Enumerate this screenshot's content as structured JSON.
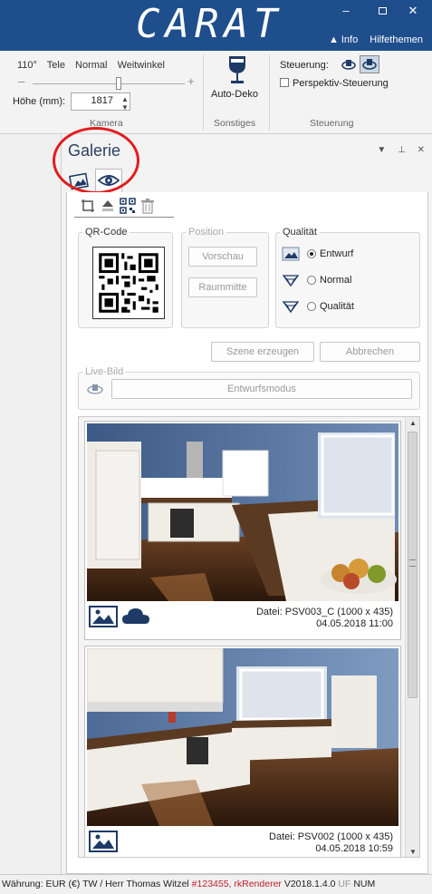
{
  "titlebar": {
    "logo": "CARAT",
    "min": "–",
    "close": "✕",
    "info": "▲ Info",
    "help": "Hilfethemen",
    "bg_color": "#1f4e8c"
  },
  "ribbon": {
    "camera": {
      "presets": [
        "110°",
        "Tele",
        "Normal",
        "Weitwinkel"
      ],
      "minus": "–",
      "plus": "+",
      "height_label": "Höhe (mm):",
      "height_value": "1817",
      "group_label": "Kamera"
    },
    "sonstiges": {
      "autodeko_label": "Auto-Deko",
      "group_label": "Sonstiges"
    },
    "steuerung": {
      "label": "Steuerung:",
      "perspektiv_label": "Perspektiv-Steuerung",
      "group_label": "Steuerung"
    }
  },
  "gallery": {
    "title": "Galerie",
    "ctrl_dropdown": "▼",
    "ctrl_pin": "⊥",
    "ctrl_close": "✕",
    "highlight_color": "#e01e1e",
    "qr": {
      "title": "QR-Code"
    },
    "position": {
      "title": "Position",
      "preview_button": "Vorschau",
      "center_button": "Raummitte"
    },
    "quality": {
      "title": "Qualität",
      "options": [
        "Entwurf",
        "Normal",
        "Qualität"
      ],
      "selected": "Entwurf"
    },
    "create_button": "Szene erzeugen",
    "cancel_button": "Abbrechen",
    "live": {
      "title": "Live-Bild",
      "mode_button": "Entwurfsmodus"
    },
    "images": [
      {
        "file": "Datei: PSV003_C (1000 x 435)",
        "date": "04.05.2018 11:00"
      },
      {
        "file": "Datei: PSV002 (1000 x 435)",
        "date": "04.05.2018 10:59"
      }
    ]
  },
  "status": {
    "currency": "Währung: EUR (€)",
    "user": "TW / Herr Thomas Witzel",
    "license": "#123455, rkRenderer",
    "version": "V2018.1.4.0",
    "uf": "UF",
    "num": "NUM"
  }
}
